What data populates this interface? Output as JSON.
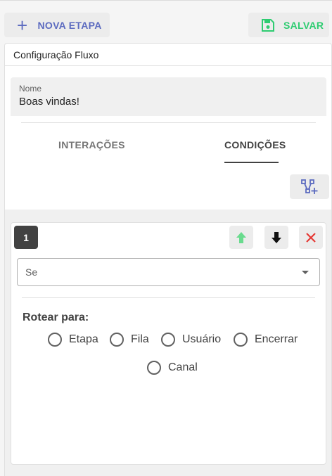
{
  "toolbar": {
    "new_step_label": "NOVA ETAPA",
    "save_label": "SALVAR",
    "accent_color": "#5c6bc0",
    "save_color": "#2ecc71"
  },
  "panel": {
    "title": "Configuração Fluxo"
  },
  "name_field": {
    "label": "Nome",
    "value": "Boas vindas!"
  },
  "tabs": [
    {
      "label": "INTERAÇÕES",
      "active": false
    },
    {
      "label": "CONDIÇÕES",
      "active": true
    }
  ],
  "condition": {
    "number": "1",
    "select_placeholder": "Se",
    "route_label": "Rotear para:",
    "options": [
      "Etapa",
      "Fila",
      "Usuário",
      "Encerrar",
      "Canal"
    ]
  },
  "icons": {
    "new_step": "plus-icon",
    "save": "floppy-disk-icon",
    "graph": "graph-add-icon",
    "move_up": "arrow-up-icon",
    "move_down": "arrow-down-icon",
    "delete": "close-icon",
    "select_caret": "caret-down-icon"
  }
}
